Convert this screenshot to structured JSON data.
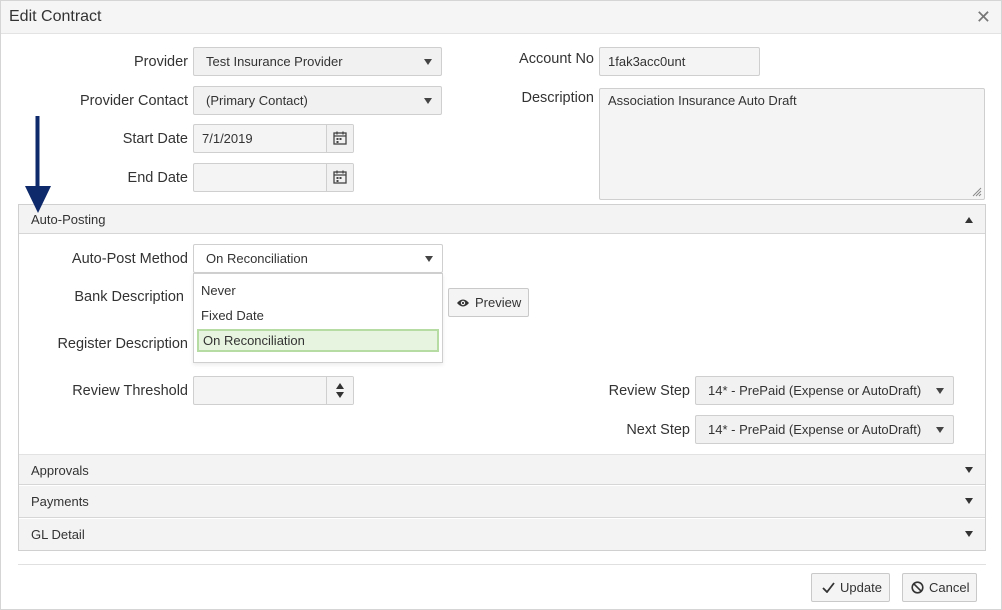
{
  "dialog": {
    "title": "Edit Contract"
  },
  "fields": {
    "provider": {
      "label": "Provider",
      "value": "Test Insurance Provider"
    },
    "provider_contact": {
      "label": "Provider Contact",
      "value": "(Primary Contact)"
    },
    "start_date": {
      "label": "Start Date",
      "value": "7/1/2019"
    },
    "end_date": {
      "label": "End Date",
      "value": ""
    },
    "account_no": {
      "label": "Account No",
      "value": "1fak3acc0unt"
    },
    "description": {
      "label": "Description",
      "value": "Association Insurance Auto Draft"
    }
  },
  "sections": {
    "auto_posting": {
      "label": "Auto-Posting"
    },
    "approvals": {
      "label": "Approvals"
    },
    "payments": {
      "label": "Payments"
    },
    "gl_detail": {
      "label": "GL Detail"
    }
  },
  "auto_posting": {
    "method_label": "Auto-Post Method",
    "method_value": "On Reconciliation",
    "method_options": [
      "Never",
      "Fixed Date",
      "On Reconciliation"
    ],
    "bank_description_label": "Bank Description",
    "register_description_label": "Register Description",
    "preview_label": "Preview",
    "review_threshold_label": "Review Threshold",
    "review_threshold_value": "",
    "review_step_label": "Review Step",
    "review_step_value": "14* - PrePaid (Expense or AutoDraft)",
    "next_step_label": "Next Step",
    "next_step_value": "14* - PrePaid (Expense or AutoDraft)"
  },
  "footer": {
    "update_label": "Update",
    "cancel_label": "Cancel"
  },
  "icons": {
    "close": "close-icon",
    "calendar": "calendar-icon",
    "eye": "eye-icon",
    "check": "check-icon",
    "ban": "ban-icon",
    "arrow": "annotation-arrow-icon"
  },
  "colors": {
    "annotation_arrow": "#0f2a6b",
    "selected_option_bg": "#e7f4df",
    "selected_option_border": "#b7dca3"
  }
}
